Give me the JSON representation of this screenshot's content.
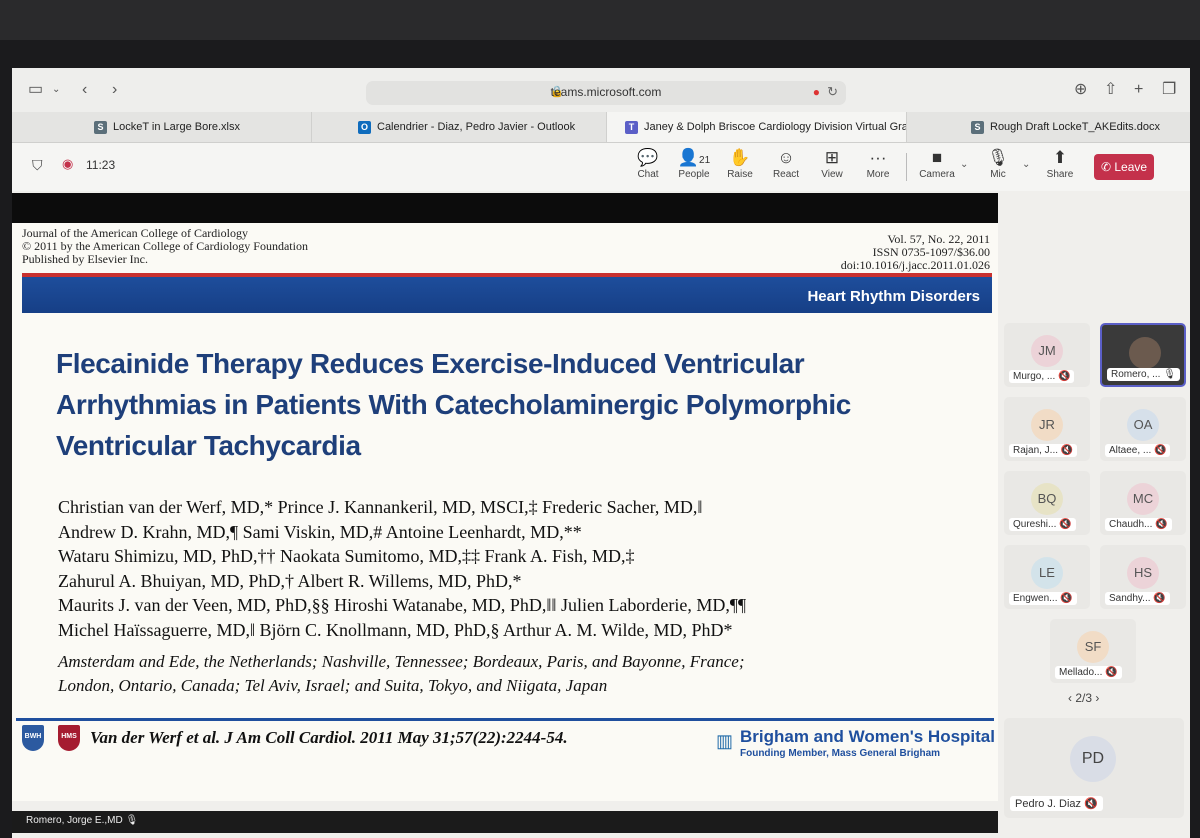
{
  "browser": {
    "url": "teams.microsoft.com",
    "tabs": [
      {
        "icon_letter": "S",
        "icon_color": "#5b6f7a",
        "label": "LockeT in Large Bore.xlsx"
      },
      {
        "icon_letter": "O",
        "icon_color": "#0f6cbd",
        "label": "Calendrier - Diaz, Pedro Javier - Outlook"
      },
      {
        "icon_letter": "T",
        "icon_color": "#5b5fc7",
        "label": "Janey & Dolph Briscoe Cardiology Division Virtual Gran..."
      },
      {
        "icon_letter": "S",
        "icon_color": "#5b6f7a",
        "label": "Rough Draft LockeT_AKEdits.docx"
      }
    ]
  },
  "teams": {
    "time": "11:23",
    "people_count": "21",
    "buttons": {
      "chat": "Chat",
      "people": "People",
      "raise": "Raise",
      "react": "React",
      "view": "View",
      "more": "More",
      "camera": "Camera",
      "mic": "Mic",
      "share": "Share"
    },
    "leave": "Leave"
  },
  "slide": {
    "journal_left": [
      "Journal of the American College of Cardiology",
      "© 2011 by the American College of Cardiology Foundation",
      "Published by Elsevier Inc."
    ],
    "journal_right": [
      "Vol. 57, No. 22, 2011",
      "ISSN 0735-1097/$36.00",
      "doi:10.1016/j.jacc.2011.01.026"
    ],
    "section": "Heart Rhythm Disorders",
    "title": "Flecainide Therapy Reduces Exercise-Induced Ventricular Arrhythmias in Patients With Catecholaminergic Polymorphic Ventricular Tachycardia",
    "authors": [
      "Christian van der Werf, MD,* Prince J. Kannankeril, MD, MSCI,‡ Frederic Sacher, MD,‖",
      "Andrew D. Krahn, MD,¶ Sami Viskin, MD,# Antoine Leenhardt, MD,**",
      "Wataru Shimizu, MD, PhD,†† Naokata Sumitomo, MD,‡‡ Frank A. Fish, MD,‡",
      "Zahurul A. Bhuiyan, MD, PhD,† Albert R. Willems, MD, PhD,*",
      "Maurits J. van der Veen, MD, PhD,§§ Hiroshi Watanabe, MD, PhD,‖‖ Julien Laborderie, MD,¶¶",
      "Michel Haïssaguerre, MD,‖ Björn C. Knollmann, MD, PhD,§ Arthur A. M. Wilde, MD, PhD*"
    ],
    "affiliations": [
      "Amsterdam and Ede, the Netherlands; Nashville, Tennessee; Bordeaux, Paris, and Bayonne, France;",
      "London, Ontario, Canada; Tel Aviv, Israel; and Suita, Tokyo, and Niigata, Japan"
    ],
    "bwh_logo": "BWH",
    "hms_logo": "HMS",
    "citation": "Van der Werf et al. J Am Coll Cardiol. 2011 May 31;57(22):2244-54.",
    "hospital": "Brigham and Women's Hospital",
    "hospital_sub": "Founding Member, Mass General Brigham",
    "presenter": "Romero, Jorge E.,MD"
  },
  "participants": [
    {
      "initials": "JM",
      "name": "Murgo, ...",
      "color": "#ecd3d8"
    },
    {
      "initials": "",
      "name": "Romero, ...",
      "color": "#3a3a3a"
    },
    {
      "initials": "JR",
      "name": "Rajan, J...",
      "color": "#f1dcc6"
    },
    {
      "initials": "OA",
      "name": "Altaee, ...",
      "color": "#d6e0ea"
    },
    {
      "initials": "BQ",
      "name": "Qureshi...",
      "color": "#e7e3c6"
    },
    {
      "initials": "MC",
      "name": "Chaudh...",
      "color": "#ecd3d8"
    },
    {
      "initials": "LE",
      "name": "Engwen...",
      "color": "#d3e3ea"
    },
    {
      "initials": "HS",
      "name": "Sandhy...",
      "color": "#ecd3d8"
    },
    {
      "initials": "SF",
      "name": "Mellado...",
      "color": "#f1dcc6"
    }
  ],
  "pager": "2/3",
  "self": {
    "initials": "PD",
    "name": "Pedro J. Diaz"
  }
}
